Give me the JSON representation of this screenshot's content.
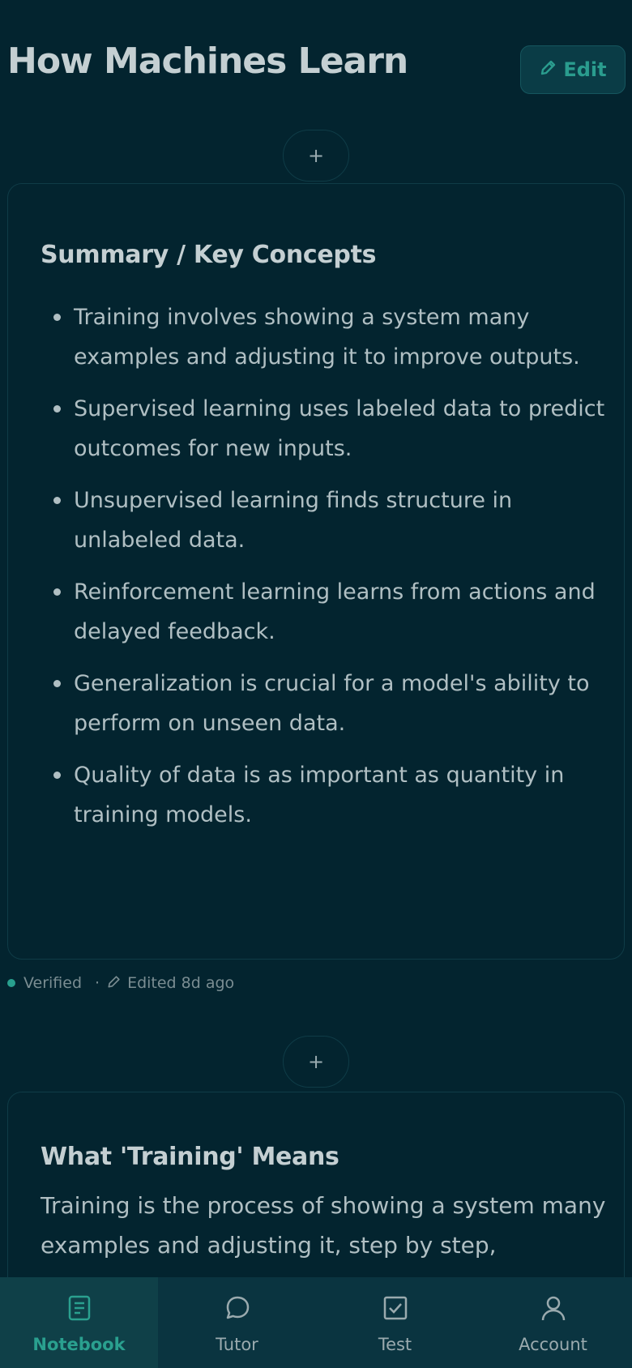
{
  "header": {
    "title": "How Machines Learn",
    "edit_label": "Edit"
  },
  "add_button_label": "+",
  "cards": [
    {
      "title": "Summary / Key Concepts",
      "bullets": [
        "Training involves showing a system many examples and adjusting it to improve outputs.",
        "Supervised learning uses labeled data to predict outcomes for new inputs.",
        "Unsupervised learning finds structure in unlabeled data.",
        "Reinforcement learning learns from actions and delayed feedback.",
        "Generalization is crucial for a model's ability to perform on unseen data.",
        "Quality of data is as important as quantity in training models."
      ],
      "meta": {
        "status": "Verified",
        "separator": "·",
        "edited": "Edited 8d ago"
      }
    },
    {
      "title": "What 'Training' Means",
      "paragraph": "Training is the process of showing a system many examples and adjusting it, step by step,"
    }
  ],
  "nav": {
    "items": [
      {
        "label": "Notebook",
        "icon": "notebook-icon",
        "active": true
      },
      {
        "label": "Tutor",
        "icon": "chat-bubble-icon",
        "active": false
      },
      {
        "label": "Test",
        "icon": "checkbox-icon",
        "active": false
      },
      {
        "label": "Account",
        "icon": "person-icon",
        "active": false
      }
    ]
  },
  "colors": {
    "background": "#03242f",
    "accent": "#2aa08f",
    "nav_background": "#0a3440"
  }
}
